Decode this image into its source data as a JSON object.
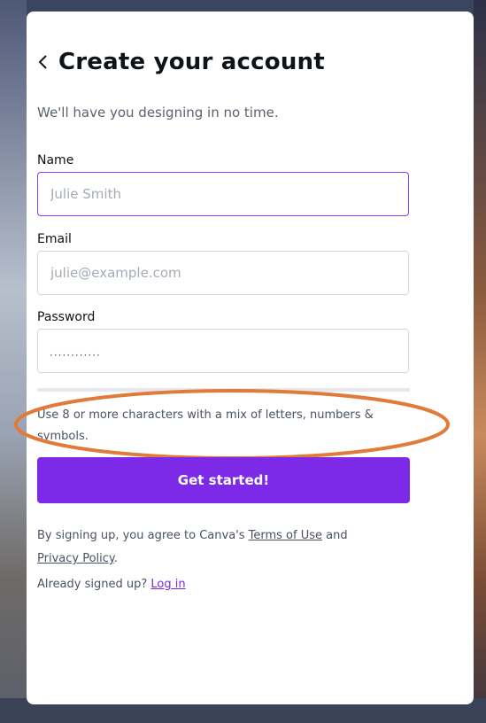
{
  "header": {
    "title": "Create your account",
    "subtitle": "We'll have you designing in no time.",
    "back_icon": "chevron-left-icon"
  },
  "form": {
    "name": {
      "label": "Name",
      "value": "",
      "placeholder": "Julie Smith"
    },
    "email": {
      "label": "Email",
      "value": "",
      "placeholder": "julie@example.com"
    },
    "password": {
      "label": "Password",
      "masked_value": "············"
    },
    "password_hint": "Use 8 or more characters with a mix of letters, numbers & symbols.",
    "submit_label": "Get started!"
  },
  "legal": {
    "prefix": "By signing up, you agree to Canva's ",
    "terms_link": "Terms of Use",
    "middle": " and ",
    "privacy_link": "Privacy Policy",
    "suffix": "."
  },
  "login": {
    "prompt": "Already signed up? ",
    "link": "Log in"
  },
  "colors": {
    "accent": "#7d2ae8",
    "focus_border": "#8b3dff",
    "annotation": "#e07b39"
  }
}
